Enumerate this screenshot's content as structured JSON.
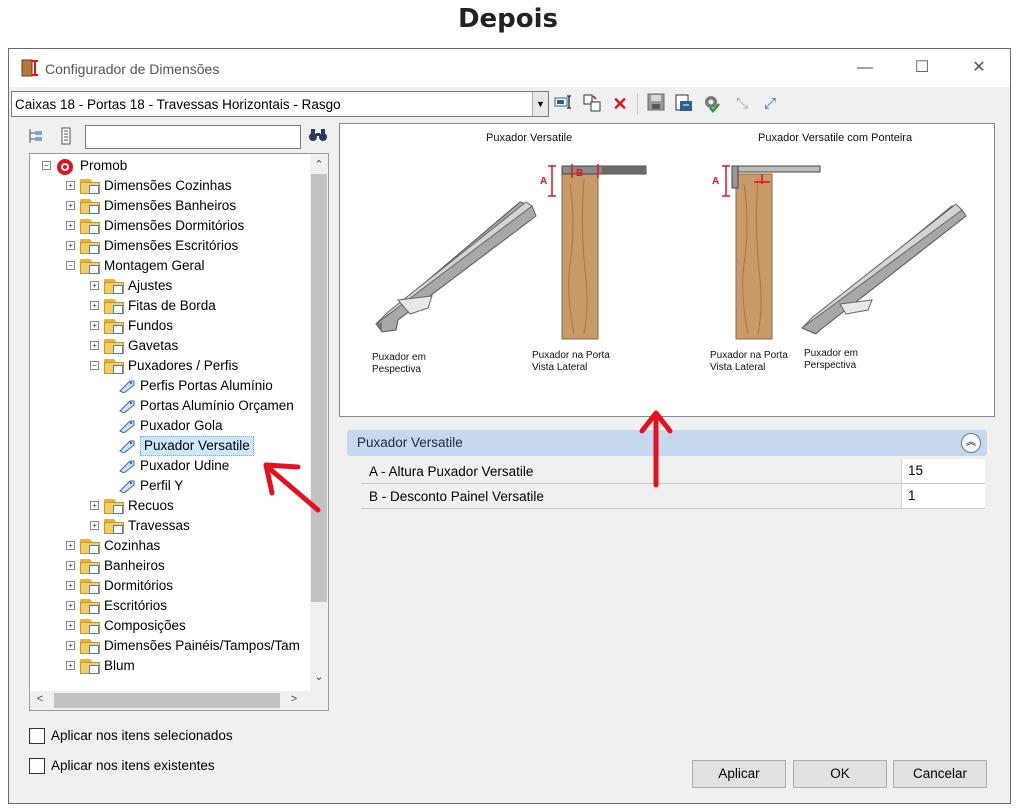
{
  "page_title": "Depois",
  "window": {
    "title": "Configurador de Dimensões",
    "minimize": "—",
    "maximize": "☐",
    "close": "✕"
  },
  "combo": {
    "value": "Caixas 18 - Portas 18 - Travessas Horizontais - Rasgo"
  },
  "search": {
    "placeholder": ""
  },
  "tree": [
    {
      "label": "Promob",
      "level": 0,
      "expander": "−",
      "icon": "promob"
    },
    {
      "label": "Dimensões Cozinhas",
      "level": 1,
      "expander": "+",
      "icon": "folder"
    },
    {
      "label": "Dimensões Banheiros",
      "level": 1,
      "expander": "+",
      "icon": "folder"
    },
    {
      "label": "Dimensões Dormitórios",
      "level": 1,
      "expander": "+",
      "icon": "folder"
    },
    {
      "label": "Dimensões Escritórios",
      "level": 1,
      "expander": "+",
      "icon": "folder"
    },
    {
      "label": "Montagem Geral",
      "level": 1,
      "expander": "−",
      "icon": "folder"
    },
    {
      "label": "Ajustes",
      "level": 2,
      "expander": "+",
      "icon": "folder"
    },
    {
      "label": "Fitas de Borda",
      "level": 2,
      "expander": "+",
      "icon": "folder"
    },
    {
      "label": "Fundos",
      "level": 2,
      "expander": "+",
      "icon": "folder"
    },
    {
      "label": "Gavetas",
      "level": 2,
      "expander": "+",
      "icon": "folder"
    },
    {
      "label": "Puxadores / Perfis",
      "level": 2,
      "expander": "−",
      "icon": "folder"
    },
    {
      "label": "Perfis Portas Alumínio",
      "level": 3,
      "expander": "",
      "icon": "tag"
    },
    {
      "label": "Portas Alumínio Orçamen",
      "level": 3,
      "expander": "",
      "icon": "tag"
    },
    {
      "label": "Puxador Gola",
      "level": 3,
      "expander": "",
      "icon": "tag"
    },
    {
      "label": "Puxador Versatile",
      "level": 3,
      "expander": "",
      "icon": "tag",
      "selected": true
    },
    {
      "label": "Puxador Udine",
      "level": 3,
      "expander": "",
      "icon": "tag"
    },
    {
      "label": "Perfil Y",
      "level": 3,
      "expander": "",
      "icon": "tag"
    },
    {
      "label": "Recuos",
      "level": 2,
      "expander": "+",
      "icon": "folder"
    },
    {
      "label": "Travessas",
      "level": 2,
      "expander": "+",
      "icon": "folder"
    },
    {
      "label": "Cozinhas",
      "level": 1,
      "expander": "+",
      "icon": "folder"
    },
    {
      "label": "Banheiros",
      "level": 1,
      "expander": "+",
      "icon": "folder"
    },
    {
      "label": "Dormitórios",
      "level": 1,
      "expander": "+",
      "icon": "folder"
    },
    {
      "label": "Escritórios",
      "level": 1,
      "expander": "+",
      "icon": "folder"
    },
    {
      "label": "Composições",
      "level": 1,
      "expander": "+",
      "icon": "folder"
    },
    {
      "label": "Dimensões Painéis/Tampos/Tam",
      "level": 1,
      "expander": "+",
      "icon": "folder"
    },
    {
      "label": "Blum",
      "level": 1,
      "expander": "+",
      "icon": "folder"
    }
  ],
  "preview": {
    "left_title": "Puxador Versatile",
    "right_title": "Puxador Versatile com Ponteira",
    "cap_left_persp": "Puxador em\nPespectiva",
    "cap_left_side": "Puxador na Porta\nVista Lateral",
    "cap_right_side": "Puxador na Porta\nVista Lateral",
    "cap_right_persp": "Puxador em\nPerspectiva",
    "dim_a": "A",
    "dim_b": "B"
  },
  "properties": {
    "header": "Puxador Versatile",
    "rows": [
      {
        "label": "A - Altura Puxador Versatile",
        "value": "15"
      },
      {
        "label": "B - Desconto Painel Versatile",
        "value": "1"
      }
    ]
  },
  "checks": {
    "selected_items": "Aplicar nos itens selecionados",
    "existing_items": "Aplicar nos itens existentes"
  },
  "buttons": {
    "apply": "Aplicar",
    "ok": "OK",
    "cancel": "Cancelar"
  },
  "colors": {
    "accent_red": "#e8101e",
    "selection": "#cce8ff",
    "header_blue": "#c5d8ee"
  }
}
